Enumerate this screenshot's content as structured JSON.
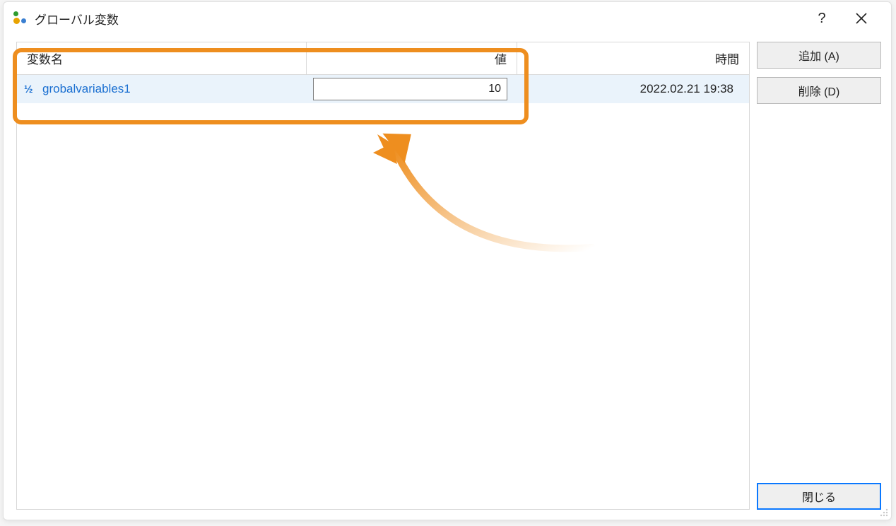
{
  "window": {
    "title": "グローバル変数"
  },
  "table": {
    "headers": {
      "name": "変数名",
      "value": "値",
      "time": "時間"
    },
    "rows": [
      {
        "name": "grobalvariables1",
        "value": "10",
        "time": "2022.02.21 19:38"
      }
    ]
  },
  "buttons": {
    "add": "追加 (A)",
    "delete": "削除 (D)",
    "close": "閉じる"
  },
  "icons": {
    "fraction": "½"
  }
}
